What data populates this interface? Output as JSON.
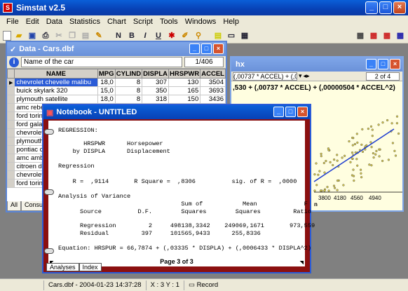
{
  "app": {
    "title": "Simstat v2.5",
    "icon": "simstat-app-icon"
  },
  "menu": [
    "File",
    "Edit",
    "Data",
    "Statistics",
    "Chart",
    "Script",
    "Tools",
    "Windows",
    "Help"
  ],
  "data_window": {
    "title": "Data - Cars.dbf",
    "var_label": "Name of the car",
    "count": "1/406",
    "columns": [
      "NAME",
      "MPG",
      "CYLIND",
      "DISPLA",
      "HRSPWR",
      "ACCEL"
    ],
    "rows": [
      [
        "chevrolet chevelle malibu",
        "18,0",
        "8",
        "307",
        "130",
        "3504"
      ],
      [
        "buick skylark 320",
        "15,0",
        "8",
        "350",
        "165",
        "3693"
      ],
      [
        "plymouth satellite",
        "18,0",
        "8",
        "318",
        "150",
        "3436"
      ],
      [
        "amc rebel sst",
        "",
        "",
        "",
        "",
        ""
      ],
      [
        "ford torino",
        "",
        "",
        "",
        "",
        ""
      ],
      [
        "ford galaxie 500",
        "",
        "",
        "",
        "",
        ""
      ],
      [
        "chevrolet impala",
        "",
        "",
        "",
        "",
        ""
      ],
      [
        "plymouth fury iii",
        "",
        "",
        "",
        "",
        ""
      ],
      [
        "pontiac catalina",
        "",
        "",
        "",
        "",
        ""
      ],
      [
        "amc ambassador",
        "",
        "",
        "",
        "",
        ""
      ],
      [
        "citroen ds21",
        "",
        "",
        "",
        "",
        ""
      ],
      [
        "chevrolet chevelle",
        "",
        "",
        "",
        "",
        ""
      ],
      [
        "ford torino 500",
        "",
        "",
        "",
        "",
        ""
      ]
    ],
    "tabs": [
      "All",
      "Consum"
    ]
  },
  "chart_window": {
    "title_suffix": "hx",
    "eq_select": "(,00737 * ACCEL) + (,00",
    "page": "2 of 4",
    "equation": ",530 + (,00737 * ACCEL) + (,00000504 * ACCEL^2)",
    "x_ticks": [
      "3800",
      "4180",
      "4560",
      "4940"
    ],
    "x_label_fragment": "n"
  },
  "notebook": {
    "title": "Notebook - UNTITLED",
    "lines": [
      "REGRESSION:",
      "       HRSPWR      Horsepower",
      "    by DISPLA      Displacement",
      "Regression",
      "    R =  ,9114       R Square =  ,8306          sig. of R =  ,0000",
      "Analysis of Variance",
      "                                  Sum of           Mean             F",
      "      Source          D.F.        Squares        Squares         Ratio",
      "      Regression         2     498138,3342    249069,1671       973,559",
      "      Residual         397     101565,9433      255,8336",
      "Equation: HRSPUR = 66,7874 + (,03335 * DISPLA) + (,0006433 * DISPLA^2)"
    ],
    "page_footer": "Page 3 of 3",
    "tabs": [
      "Analyses",
      "Index"
    ]
  },
  "status": {
    "file": "Cars.dbf - 2004-01-23  14:37:28",
    "coords": "X : 3    Y : 1",
    "record": "Record"
  }
}
